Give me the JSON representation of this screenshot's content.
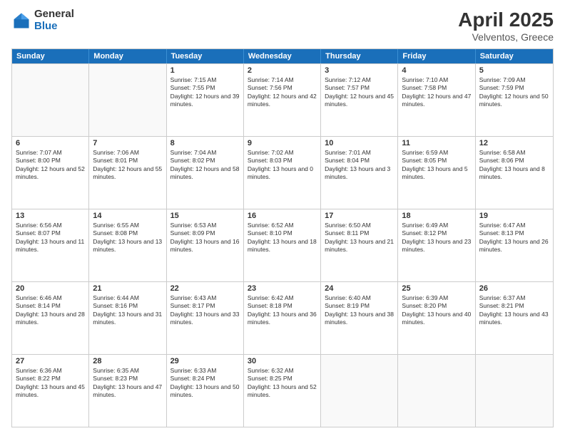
{
  "logo": {
    "general": "General",
    "blue": "Blue"
  },
  "title": {
    "month": "April 2025",
    "location": "Velventos, Greece"
  },
  "header_days": [
    "Sunday",
    "Monday",
    "Tuesday",
    "Wednesday",
    "Thursday",
    "Friday",
    "Saturday"
  ],
  "weeks": [
    [
      {
        "day": "",
        "sunrise": "",
        "sunset": "",
        "daylight": "",
        "empty": true
      },
      {
        "day": "",
        "sunrise": "",
        "sunset": "",
        "daylight": "",
        "empty": true
      },
      {
        "day": "1",
        "sunrise": "Sunrise: 7:15 AM",
        "sunset": "Sunset: 7:55 PM",
        "daylight": "Daylight: 12 hours and 39 minutes."
      },
      {
        "day": "2",
        "sunrise": "Sunrise: 7:14 AM",
        "sunset": "Sunset: 7:56 PM",
        "daylight": "Daylight: 12 hours and 42 minutes."
      },
      {
        "day": "3",
        "sunrise": "Sunrise: 7:12 AM",
        "sunset": "Sunset: 7:57 PM",
        "daylight": "Daylight: 12 hours and 45 minutes."
      },
      {
        "day": "4",
        "sunrise": "Sunrise: 7:10 AM",
        "sunset": "Sunset: 7:58 PM",
        "daylight": "Daylight: 12 hours and 47 minutes."
      },
      {
        "day": "5",
        "sunrise": "Sunrise: 7:09 AM",
        "sunset": "Sunset: 7:59 PM",
        "daylight": "Daylight: 12 hours and 50 minutes."
      }
    ],
    [
      {
        "day": "6",
        "sunrise": "Sunrise: 7:07 AM",
        "sunset": "Sunset: 8:00 PM",
        "daylight": "Daylight: 12 hours and 52 minutes."
      },
      {
        "day": "7",
        "sunrise": "Sunrise: 7:06 AM",
        "sunset": "Sunset: 8:01 PM",
        "daylight": "Daylight: 12 hours and 55 minutes."
      },
      {
        "day": "8",
        "sunrise": "Sunrise: 7:04 AM",
        "sunset": "Sunset: 8:02 PM",
        "daylight": "Daylight: 12 hours and 58 minutes."
      },
      {
        "day": "9",
        "sunrise": "Sunrise: 7:02 AM",
        "sunset": "Sunset: 8:03 PM",
        "daylight": "Daylight: 13 hours and 0 minutes."
      },
      {
        "day": "10",
        "sunrise": "Sunrise: 7:01 AM",
        "sunset": "Sunset: 8:04 PM",
        "daylight": "Daylight: 13 hours and 3 minutes."
      },
      {
        "day": "11",
        "sunrise": "Sunrise: 6:59 AM",
        "sunset": "Sunset: 8:05 PM",
        "daylight": "Daylight: 13 hours and 5 minutes."
      },
      {
        "day": "12",
        "sunrise": "Sunrise: 6:58 AM",
        "sunset": "Sunset: 8:06 PM",
        "daylight": "Daylight: 13 hours and 8 minutes."
      }
    ],
    [
      {
        "day": "13",
        "sunrise": "Sunrise: 6:56 AM",
        "sunset": "Sunset: 8:07 PM",
        "daylight": "Daylight: 13 hours and 11 minutes."
      },
      {
        "day": "14",
        "sunrise": "Sunrise: 6:55 AM",
        "sunset": "Sunset: 8:08 PM",
        "daylight": "Daylight: 13 hours and 13 minutes."
      },
      {
        "day": "15",
        "sunrise": "Sunrise: 6:53 AM",
        "sunset": "Sunset: 8:09 PM",
        "daylight": "Daylight: 13 hours and 16 minutes."
      },
      {
        "day": "16",
        "sunrise": "Sunrise: 6:52 AM",
        "sunset": "Sunset: 8:10 PM",
        "daylight": "Daylight: 13 hours and 18 minutes."
      },
      {
        "day": "17",
        "sunrise": "Sunrise: 6:50 AM",
        "sunset": "Sunset: 8:11 PM",
        "daylight": "Daylight: 13 hours and 21 minutes."
      },
      {
        "day": "18",
        "sunrise": "Sunrise: 6:49 AM",
        "sunset": "Sunset: 8:12 PM",
        "daylight": "Daylight: 13 hours and 23 minutes."
      },
      {
        "day": "19",
        "sunrise": "Sunrise: 6:47 AM",
        "sunset": "Sunset: 8:13 PM",
        "daylight": "Daylight: 13 hours and 26 minutes."
      }
    ],
    [
      {
        "day": "20",
        "sunrise": "Sunrise: 6:46 AM",
        "sunset": "Sunset: 8:14 PM",
        "daylight": "Daylight: 13 hours and 28 minutes."
      },
      {
        "day": "21",
        "sunrise": "Sunrise: 6:44 AM",
        "sunset": "Sunset: 8:16 PM",
        "daylight": "Daylight: 13 hours and 31 minutes."
      },
      {
        "day": "22",
        "sunrise": "Sunrise: 6:43 AM",
        "sunset": "Sunset: 8:17 PM",
        "daylight": "Daylight: 13 hours and 33 minutes."
      },
      {
        "day": "23",
        "sunrise": "Sunrise: 6:42 AM",
        "sunset": "Sunset: 8:18 PM",
        "daylight": "Daylight: 13 hours and 36 minutes."
      },
      {
        "day": "24",
        "sunrise": "Sunrise: 6:40 AM",
        "sunset": "Sunset: 8:19 PM",
        "daylight": "Daylight: 13 hours and 38 minutes."
      },
      {
        "day": "25",
        "sunrise": "Sunrise: 6:39 AM",
        "sunset": "Sunset: 8:20 PM",
        "daylight": "Daylight: 13 hours and 40 minutes."
      },
      {
        "day": "26",
        "sunrise": "Sunrise: 6:37 AM",
        "sunset": "Sunset: 8:21 PM",
        "daylight": "Daylight: 13 hours and 43 minutes."
      }
    ],
    [
      {
        "day": "27",
        "sunrise": "Sunrise: 6:36 AM",
        "sunset": "Sunset: 8:22 PM",
        "daylight": "Daylight: 13 hours and 45 minutes."
      },
      {
        "day": "28",
        "sunrise": "Sunrise: 6:35 AM",
        "sunset": "Sunset: 8:23 PM",
        "daylight": "Daylight: 13 hours and 47 minutes."
      },
      {
        "day": "29",
        "sunrise": "Sunrise: 6:33 AM",
        "sunset": "Sunset: 8:24 PM",
        "daylight": "Daylight: 13 hours and 50 minutes."
      },
      {
        "day": "30",
        "sunrise": "Sunrise: 6:32 AM",
        "sunset": "Sunset: 8:25 PM",
        "daylight": "Daylight: 13 hours and 52 minutes."
      },
      {
        "day": "",
        "sunrise": "",
        "sunset": "",
        "daylight": "",
        "empty": true
      },
      {
        "day": "",
        "sunrise": "",
        "sunset": "",
        "daylight": "",
        "empty": true
      },
      {
        "day": "",
        "sunrise": "",
        "sunset": "",
        "daylight": "",
        "empty": true
      }
    ]
  ]
}
